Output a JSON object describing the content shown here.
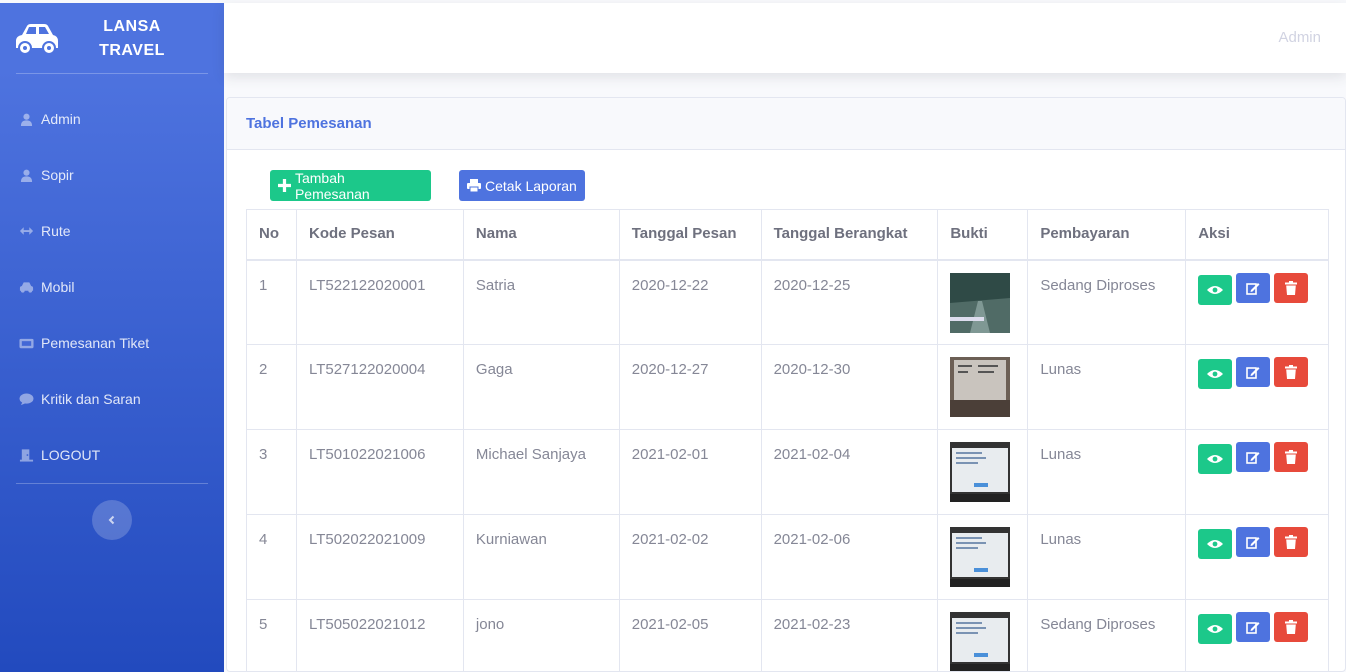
{
  "brand": {
    "line1": "LANSA",
    "line2": "TRAVEL",
    "icon": "car-icon"
  },
  "sidebar": {
    "items": [
      {
        "label": "Admin",
        "icon": "user-icon"
      },
      {
        "label": "Sopir",
        "icon": "user-icon"
      },
      {
        "label": "Rute",
        "icon": "arrows-h-icon"
      },
      {
        "label": "Mobil",
        "icon": "car-icon"
      },
      {
        "label": "Pemesanan Tiket",
        "icon": "ticket-icon"
      },
      {
        "label": "Kritik dan Saran",
        "icon": "comment-icon"
      },
      {
        "label": "LOGOUT",
        "icon": "door-icon"
      }
    ],
    "toggle_icon": "chevron-left-icon"
  },
  "topbar": {
    "user": "Admin"
  },
  "card": {
    "title": "Tabel Pemesanan",
    "add_button": "Tambah Pemesanan",
    "print_button": "Cetak Laporan"
  },
  "table": {
    "headers": [
      "No",
      "Kode Pesan",
      "Nama",
      "Tanggal Pesan",
      "Tanggal Berangkat",
      "Bukti",
      "Pembayaran",
      "Aksi"
    ],
    "rows": [
      {
        "no": "1",
        "kode": "LT522122020001",
        "nama": "Satria",
        "tgl_pesan": "2020-12-22",
        "tgl_berangkat": "2020-12-25",
        "bukti": "road-photo",
        "pembayaran": "Sedang Diproses"
      },
      {
        "no": "2",
        "kode": "LT527122020004",
        "nama": "Gaga",
        "tgl_pesan": "2020-12-27",
        "tgl_berangkat": "2020-12-30",
        "bukti": "receipt-photo",
        "pembayaran": "Lunas"
      },
      {
        "no": "3",
        "kode": "LT501022021006",
        "nama": "Michael Sanjaya",
        "tgl_pesan": "2021-02-01",
        "tgl_berangkat": "2021-02-04",
        "bukti": "screen-photo",
        "pembayaran": "Lunas"
      },
      {
        "no": "4",
        "kode": "LT502022021009",
        "nama": "Kurniawan",
        "tgl_pesan": "2021-02-02",
        "tgl_berangkat": "2021-02-06",
        "bukti": "screen-photo",
        "pembayaran": "Lunas"
      },
      {
        "no": "5",
        "kode": "LT505022021012",
        "nama": "jono",
        "tgl_pesan": "2021-02-05",
        "tgl_berangkat": "2021-02-23",
        "bukti": "screen-photo",
        "pembayaran": "Sedang Diproses"
      }
    ]
  },
  "colors": {
    "primary": "#4e73df",
    "success": "#1cc88a",
    "danger": "#e74a3b"
  }
}
